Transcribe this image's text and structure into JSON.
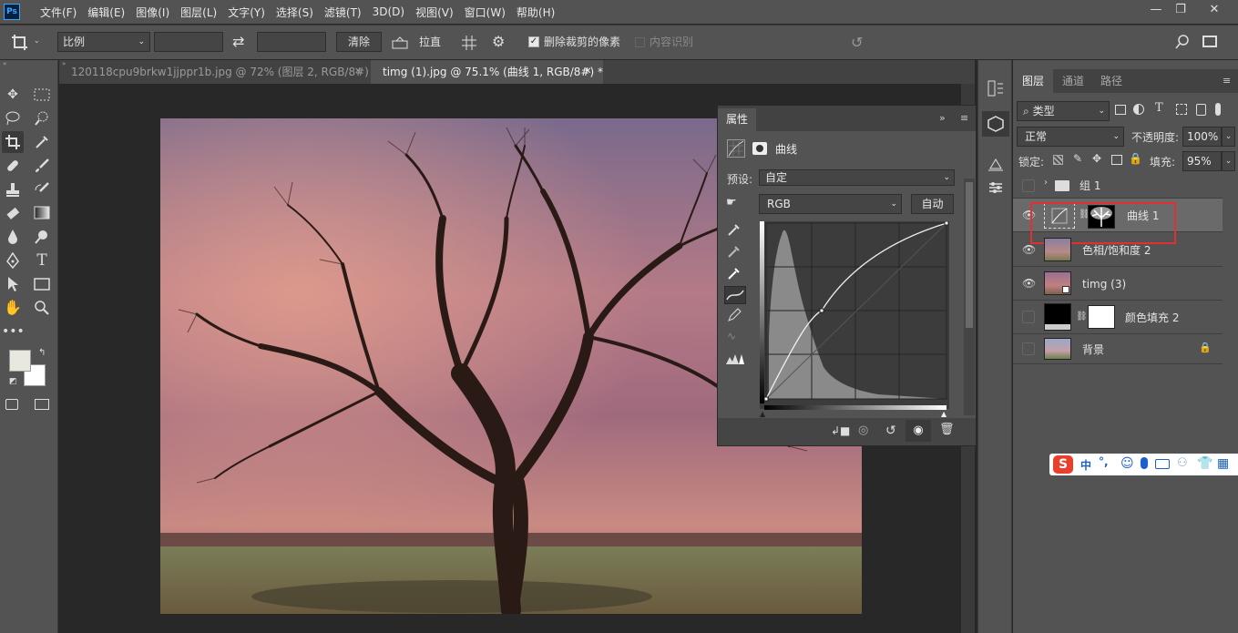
{
  "app": {
    "logo": "Ps"
  },
  "menu": [
    "文件(F)",
    "编辑(E)",
    "图像(I)",
    "图层(L)",
    "文字(Y)",
    "选择(S)",
    "滤镜(T)",
    "3D(D)",
    "视图(V)",
    "窗口(W)",
    "帮助(H)"
  ],
  "window_controls": {
    "minimize": "—",
    "restore": "❐",
    "close": "✕"
  },
  "options": {
    "ratio_select": "比例",
    "swap_icon": "⇄",
    "clear_button": "清除",
    "straighten_label": "拉直",
    "delete_cropped_label": "删除裁剪的像素",
    "content_aware_label": "内容识别",
    "delete_cropped_checked": true
  },
  "tabs": [
    {
      "title": "120118cpu9brkw1jjppr1b.jpg @ 72% (图层 2, RGB/8#) *",
      "close": "✕",
      "active": false
    },
    {
      "title": "timg (1).jpg @ 75.1% (曲线 1, RGB/8#) *",
      "close": "✕",
      "active": true
    }
  ],
  "properties": {
    "tab": "属性",
    "type_label": "曲线",
    "preset_label": "预设:",
    "preset_value": "自定",
    "channel_value": "RGB",
    "auto_button": "自动"
  },
  "layers_panel": {
    "tabs": [
      "图层",
      "通道",
      "路径"
    ],
    "filter_kind": "类型",
    "blend_mode": "正常",
    "opacity_label": "不透明度:",
    "opacity_value": "100%",
    "lock_label": "锁定:",
    "fill_label": "填充:",
    "fill_value": "95%",
    "layers": [
      {
        "name": "组 1",
        "visible": false,
        "type": "group"
      },
      {
        "name": "曲线 1",
        "visible": true,
        "type": "curves",
        "selected": true
      },
      {
        "name": "色相/饱和度 2",
        "visible": true,
        "type": "image"
      },
      {
        "name": "timg (3)",
        "visible": true,
        "type": "smart"
      },
      {
        "name": "颜色填充 2",
        "visible": false,
        "type": "fill"
      },
      {
        "name": "背景",
        "visible": false,
        "type": "background",
        "locked": true
      }
    ]
  },
  "ime": {
    "label": "中",
    "punct": "°,"
  },
  "colors": {
    "foreground": "#e8e8df",
    "background": "#ffffff",
    "highlight": "#e03030",
    "accent": "#31a8ff"
  }
}
